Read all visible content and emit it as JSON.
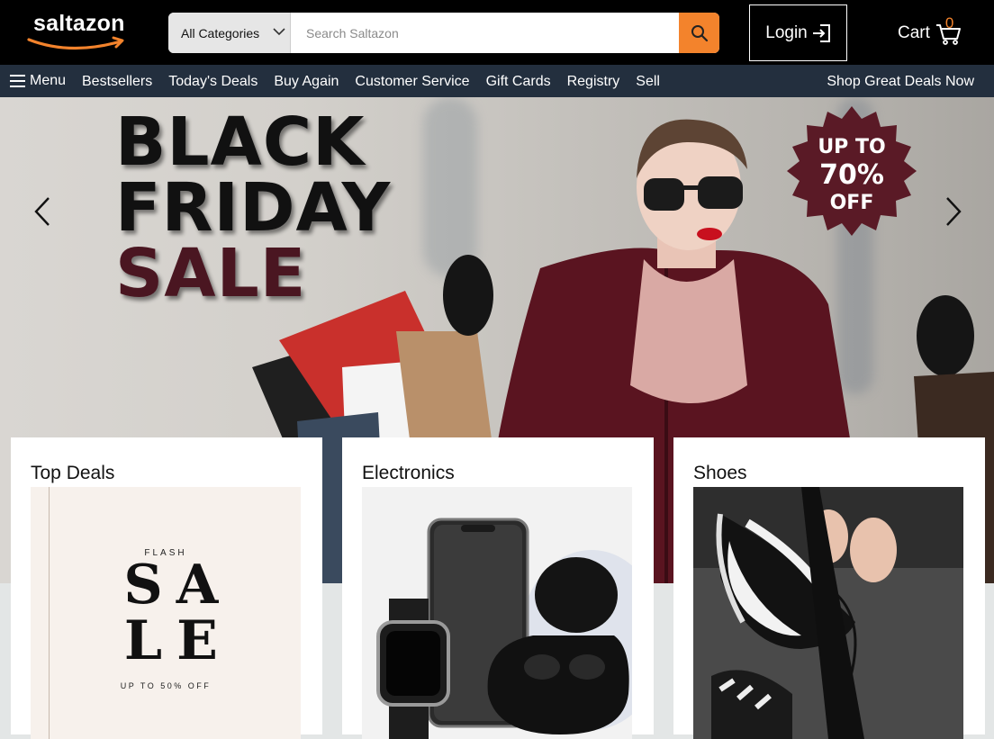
{
  "brand": {
    "name": "saltazon"
  },
  "search": {
    "category": "All Categories",
    "placeholder": "Search Saltazon"
  },
  "account": {
    "login_label": "Login"
  },
  "cart": {
    "label": "Cart",
    "count": "0"
  },
  "nav": {
    "menu_label": "Menu",
    "items": [
      "Bestsellers",
      "Today's Deals",
      "Buy Again",
      "Customer Service",
      "Gift Cards",
      "Registry",
      "Sell"
    ],
    "promo": "Shop Great Deals Now"
  },
  "hero": {
    "line1": "BLACK",
    "line2": "FRIDAY",
    "line3": "SALE",
    "badge_line1": "UP TO",
    "badge_line2": "70%",
    "badge_line3": "OFF"
  },
  "cards": [
    {
      "title": "Top Deals",
      "image": {
        "flash": "FLASH",
        "letters": [
          "S",
          "A",
          "L",
          "E"
        ],
        "sub": "UP TO 50% OFF"
      }
    },
    {
      "title": "Electronics"
    },
    {
      "title": "Shoes"
    }
  ],
  "colors": {
    "header_bg": "#000000",
    "nav_bg": "#232f3e",
    "accent": "#f3832c",
    "sale_maroon": "#4a1621",
    "badge_maroon": "#5a1a26"
  }
}
